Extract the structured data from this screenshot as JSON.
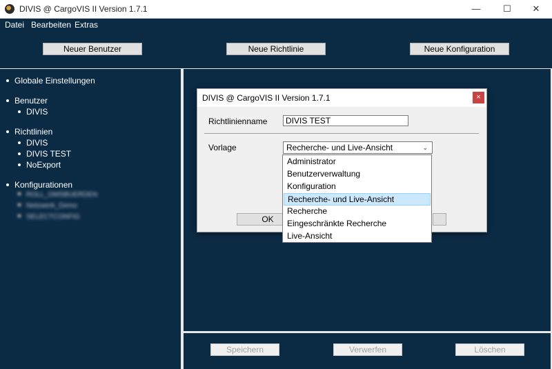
{
  "window": {
    "title": "DIVIS @ CargoVIS II Version 1.7.1",
    "minimize": "—",
    "maximize": "☐",
    "close": "✕"
  },
  "menu": [
    "Datei",
    "Bearbeiten",
    "Extras"
  ],
  "toolbar": {
    "new_user": "Neuer Benutzer",
    "new_policy": "Neue Richtlinie",
    "new_config": "Neue Konfiguration"
  },
  "tree": {
    "global": "Globale Einstellungen",
    "users_heading": "Benutzer",
    "users": [
      "DIVIS"
    ],
    "policies_heading": "Richtlinien",
    "policies": [
      "DIVIS",
      "DIVIS TEST",
      "NoExport"
    ],
    "configs_heading": "Konfigurationen",
    "configs": [
      "ROLL_OMSBUERDEN",
      "Netzwerk_Demo",
      "SELECTCONFIG"
    ]
  },
  "dialog": {
    "title": "DIVIS @ CargoVIS II Version 1.7.1",
    "close": "×",
    "name_label": "Richtlinienname",
    "name_value": "DIVIS TEST",
    "template_label": "Vorlage",
    "template_value": "Recherche- und Live-Ansicht",
    "ok": "OK",
    "cancel": ""
  },
  "dropdown": {
    "options": [
      "Administrator",
      "Benutzerverwaltung",
      "Konfiguration",
      "Recherche- und Live-Ansicht",
      "Recherche",
      "Eingeschränkte Recherche",
      "Live-Ansicht"
    ],
    "selected_index": 3
  },
  "footer": {
    "save": "Speichern",
    "discard": "Verwerfen",
    "delete": "Löschen"
  },
  "colors": {
    "background": "#0b2a44",
    "selection": "#cce8ff",
    "close_button": "#c84444"
  }
}
